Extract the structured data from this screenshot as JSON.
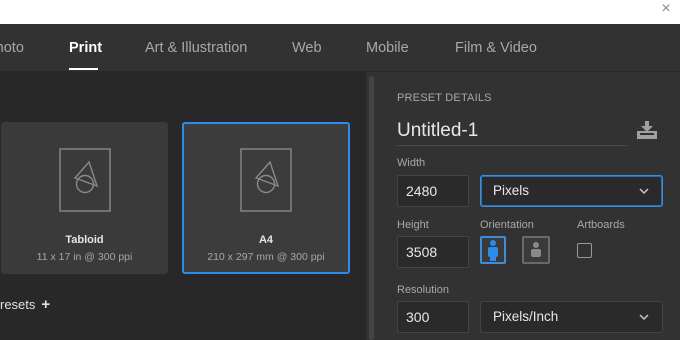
{
  "window": {
    "close_glyph": "×"
  },
  "tabs": [
    {
      "label": "Photo"
    },
    {
      "label": "Print"
    },
    {
      "label": "Art & Illustration"
    },
    {
      "label": "Web"
    },
    {
      "label": "Mobile"
    },
    {
      "label": "Film & Video"
    }
  ],
  "active_tab": "Print",
  "presets": [
    {
      "name": "Tabloid",
      "size": "11 x 17 in @ 300 ppi",
      "selected": false
    },
    {
      "name": "A4",
      "size": "210 x 297 mm @ 300 ppi",
      "selected": true
    }
  ],
  "saved_presets": {
    "label": "resets",
    "add_glyph": "+"
  },
  "preset_details": {
    "heading": "PRESET DETAILS",
    "name": "Untitled-1",
    "width_label": "Width",
    "width_value": "2480",
    "width_unit": "Pixels",
    "height_label": "Height",
    "height_value": "3508",
    "orientation_label": "Orientation",
    "orientation": "portrait",
    "artboards_label": "Artboards",
    "artboards_checked": false,
    "resolution_label": "Resolution",
    "resolution_value": "300",
    "resolution_unit": "Pixels/Inch"
  },
  "colors": {
    "accent": "#2d8ceb",
    "panel": "#323232",
    "gallery": "#282828",
    "card": "#3a3a3a"
  }
}
